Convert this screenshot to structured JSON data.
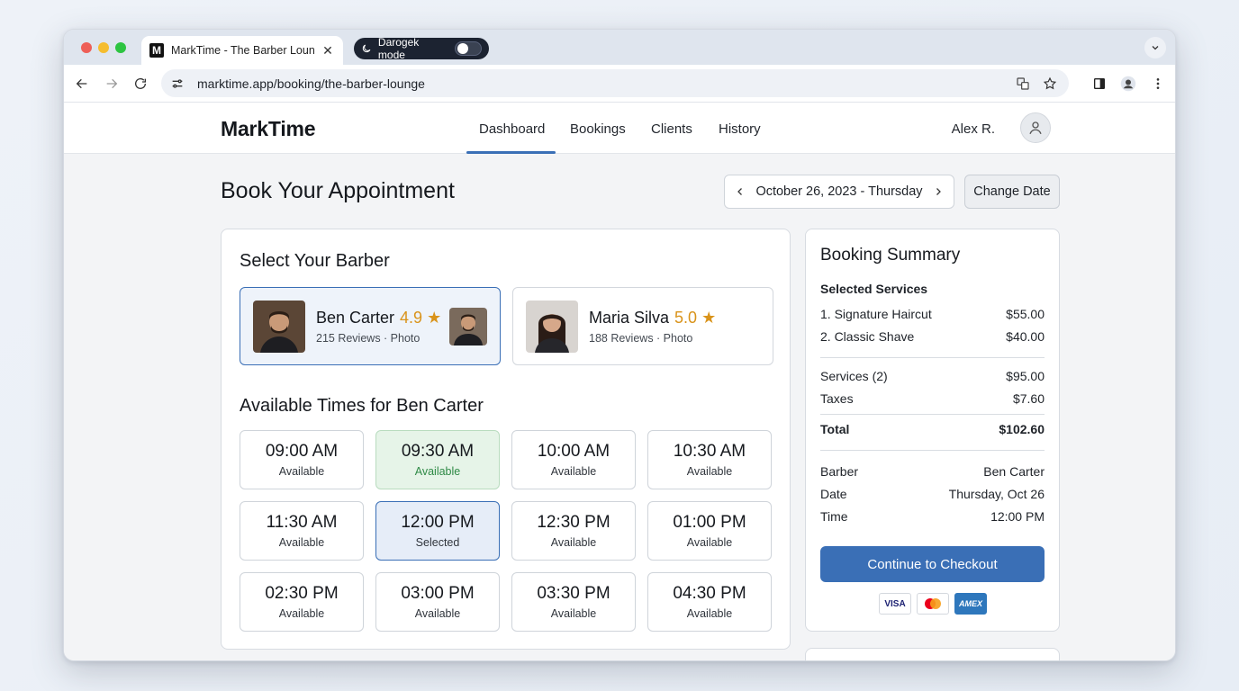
{
  "browser": {
    "tab_title": "MarkTime - The Barber Lounge",
    "favicon_letter": "M",
    "mode_pill_label": "Darogek mode",
    "url": "marktime.app/booking/the-barber-lounge"
  },
  "header": {
    "brand": "MarkTime",
    "nav": [
      "Dashboard",
      "Bookings",
      "Clients",
      "History"
    ],
    "active_nav": "Dashboard",
    "user_name": "Alex R."
  },
  "page": {
    "title": "Book Your Appointment",
    "date_label": "October 26, 2023 - Thursday",
    "change_date_label": "Change Date"
  },
  "barbers": {
    "heading": "Select Your Barber",
    "items": [
      {
        "name": "Ben Carter",
        "rating": "4.9",
        "star": "★",
        "sub": "215 Reviews · Photo",
        "selected": true
      },
      {
        "name": "Maria Silva",
        "rating": "5.0",
        "star": "★",
        "sub": "188 Reviews · Photo",
        "selected": false
      }
    ]
  },
  "times": {
    "heading": "Available Times for Ben Carter",
    "slots": [
      {
        "time": "09:00 AM",
        "status": "Available",
        "state": "normal"
      },
      {
        "time": "09:30 AM",
        "status": "Available",
        "state": "highlight"
      },
      {
        "time": "10:00 AM",
        "status": "Available",
        "state": "normal"
      },
      {
        "time": "10:30 AM",
        "status": "Available",
        "state": "normal"
      },
      {
        "time": "11:30 AM",
        "status": "Available",
        "state": "normal"
      },
      {
        "time": "12:00 PM",
        "status": "Selected",
        "state": "selected"
      },
      {
        "time": "12:30 PM",
        "status": "Available",
        "state": "normal"
      },
      {
        "time": "01:00 PM",
        "status": "Available",
        "state": "normal"
      },
      {
        "time": "02:30 PM",
        "status": "Available",
        "state": "normal"
      },
      {
        "time": "03:00 PM",
        "status": "Available",
        "state": "normal"
      },
      {
        "time": "03:30 PM",
        "status": "Available",
        "state": "normal"
      },
      {
        "time": "04:30 PM",
        "status": "Available",
        "state": "normal"
      }
    ]
  },
  "summary": {
    "title": "Booking Summary",
    "services_heading": "Selected Services",
    "services": [
      {
        "label": "1. Signature Haircut",
        "price": "$55.00"
      },
      {
        "label": "2. Classic Shave",
        "price": "$40.00"
      }
    ],
    "subtotal": {
      "label": "Services (2)",
      "value": "$95.00"
    },
    "taxes": {
      "label": "Taxes",
      "value": "$7.60"
    },
    "total": {
      "label": "Total",
      "value": "$102.60"
    },
    "details": [
      {
        "label": "Barber",
        "value": "Ben Carter"
      },
      {
        "label": "Date",
        "value": "Thursday, Oct 26"
      },
      {
        "label": "Time",
        "value": "12:00 PM"
      }
    ],
    "checkout_label": "Continue to Checkout",
    "payment_methods": [
      "VISA",
      "Mastercard",
      "AMEX"
    ]
  },
  "colors": {
    "accent": "#3a6fb6",
    "rating": "#d9931a",
    "available_green": "#2f8a46"
  }
}
